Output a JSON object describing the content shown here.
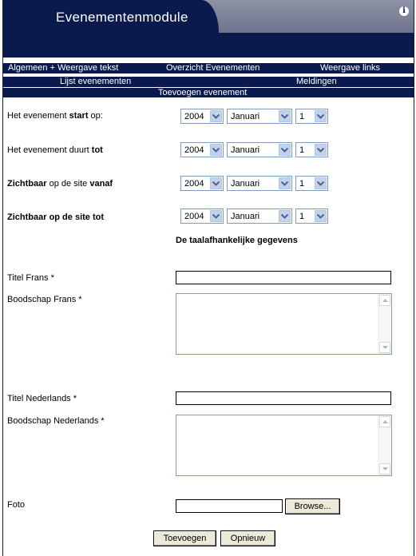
{
  "header": {
    "title": "Evenementenmodule",
    "info_icon": "i"
  },
  "nav": {
    "row1": [
      "Algemeen + Weergave tekst",
      "Overzicht Evenementen",
      "Weergave links"
    ],
    "row2": [
      "Lijst evenementen",
      "Meldingen"
    ],
    "row3": [
      "Toevoegen evenement"
    ]
  },
  "form": {
    "dates": [
      {
        "label_html_parts": [
          "Het evenement ",
          "start",
          " op:"
        ],
        "year": "2004",
        "month": "Januari",
        "day": "1"
      },
      {
        "label_html_parts": [
          "Het evenement duurt ",
          "tot",
          ""
        ],
        "year": "2004",
        "month": "Januari",
        "day": "1"
      },
      {
        "label_html_parts": [
          "Zichtbaar",
          " op de site ",
          "vanaf"
        ],
        "year": "2004",
        "month": "Januari",
        "day": "1"
      },
      {
        "label_html_parts": [
          "Zichtbaar op de site tot",
          "",
          ""
        ],
        "year": "2004",
        "month": "Januari",
        "day": "1"
      }
    ],
    "section_title": "De taalafhankelijke gegevens",
    "titel_frans_label": "Titel Frans *",
    "boodschap_frans_label": "Boodschap Frans *",
    "titel_nl_label": "Titel Nederlands *",
    "boodschap_nl_label": "Boodschap Nederlands *",
    "foto_label": "Foto",
    "browse_label": "Browse...",
    "submit_label": "Toevoegen",
    "reset_label": "Opnieuw"
  }
}
